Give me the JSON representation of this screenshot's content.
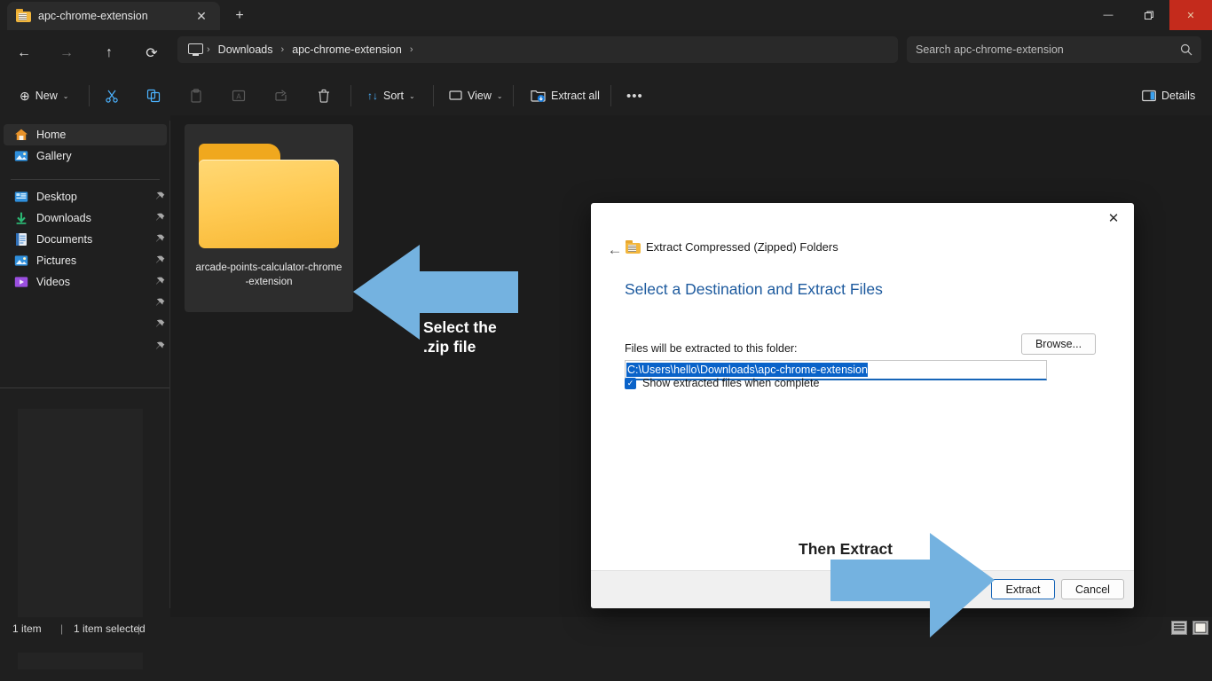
{
  "window": {
    "tab_title": "apc-chrome-extension",
    "tab_close_icon": "✕",
    "new_tab_icon": "+",
    "minimize_icon": "—",
    "maximize_icon": "❐",
    "close_icon": "✕"
  },
  "nav": {
    "back_icon": "←",
    "forward_icon": "→",
    "up_icon": "↑",
    "refresh_icon": "⟳",
    "breadcrumb": [
      "Downloads",
      "apc-chrome-extension"
    ],
    "separator": "›",
    "search_placeholder": "Search apc-chrome-extension",
    "search_icon": "⌕"
  },
  "toolbar": {
    "new_label": "New",
    "new_icon": "⊕",
    "cut_icon": "✂",
    "copy_icon": "⧉",
    "paste_icon": "📋",
    "rename_icon": "🄰",
    "share_icon": "↗",
    "delete_icon": "🗑",
    "sort_label": "Sort",
    "sort_icon": "↑↓",
    "view_label": "View",
    "view_icon": "▭",
    "extract_all_label": "Extract all",
    "extract_all_icon": "🗀",
    "more_icon": "•••",
    "details_label": "Details",
    "details_icon": "▥",
    "chevron": "⌄"
  },
  "sidebar": {
    "items": [
      {
        "label": "Home",
        "icon": "home-icon",
        "selected": true,
        "pinned": false
      },
      {
        "label": "Gallery",
        "icon": "gallery-icon",
        "selected": false,
        "pinned": false
      },
      {
        "label": "Desktop",
        "icon": "desktop-icon",
        "selected": false,
        "pinned": true
      },
      {
        "label": "Downloads",
        "icon": "downloads-icon",
        "selected": false,
        "pinned": true
      },
      {
        "label": "Documents",
        "icon": "documents-icon",
        "selected": false,
        "pinned": true
      },
      {
        "label": "Pictures",
        "icon": "pictures-icon",
        "selected": false,
        "pinned": true
      },
      {
        "label": "Videos",
        "icon": "videos-icon",
        "selected": false,
        "pinned": true
      }
    ]
  },
  "content": {
    "file_name": "arcade-points-calculator-chrome-extension",
    "file_name_line1": "arcade-points-calculator-chrome",
    "file_name_line2": "-extension",
    "file_icon": "folder-icon"
  },
  "status": {
    "item_count": "1 item",
    "selection": "1 item selected",
    "divider": "|",
    "list_view_icon": "list-view-icon",
    "tile_view_icon": "tile-view-icon"
  },
  "dialog": {
    "close_icon": "✕",
    "back_icon": "←",
    "caption": "Extract Compressed (Zipped) Folders",
    "heading": "Select a Destination and Extract Files",
    "field_label": "Files will be extracted to this folder:",
    "path_value": "C:\\Users\\hello\\Downloads\\apc-chrome-extension",
    "browse_label": "Browse...",
    "checkbox_label": "Show extracted files when complete",
    "checkbox_checked": true,
    "checkbox_glyph": "✓",
    "extract_label": "Extract",
    "cancel_label": "Cancel"
  },
  "annotations": [
    {
      "text_line1": "Select the",
      "text_line2": ".zip file",
      "direction": "left",
      "color": "#74b2e0",
      "text_color": "#ffffff"
    },
    {
      "text_line1": "Then Extract",
      "text_line2": "",
      "direction": "right",
      "color": "#74b2e0",
      "text_color": "#212121"
    }
  ],
  "colors": {
    "accent": "#4cb3ff",
    "arrow": "#74b2e0",
    "selection_blue": "#0a63c9",
    "dialog_link": "#1d5a9e",
    "window_close": "#c42b1c"
  }
}
